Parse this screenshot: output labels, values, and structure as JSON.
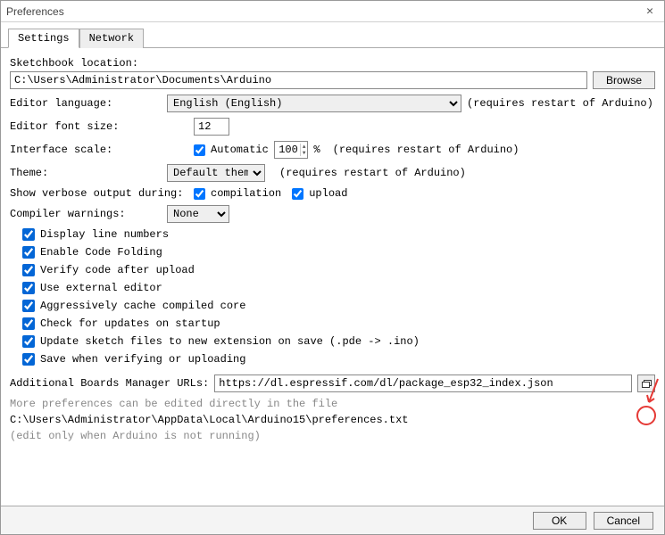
{
  "titlebar": {
    "title": "Preferences"
  },
  "tabs": {
    "settings": "Settings",
    "network": "Network"
  },
  "sketchbook": {
    "label": "Sketchbook location:",
    "path": "C:\\Users\\Administrator\\Documents\\Arduino",
    "browse": "Browse"
  },
  "editor_language": {
    "label": "Editor language:",
    "value": "English (English)",
    "note": "(requires restart of Arduino)"
  },
  "font_size": {
    "label": "Editor font size:",
    "value": "12"
  },
  "interface_scale": {
    "label": "Interface scale:",
    "automatic": "Automatic",
    "value": "100",
    "percent": "%",
    "note": "(requires restart of Arduino)"
  },
  "theme": {
    "label": "Theme:",
    "value": "Default theme",
    "note": "(requires restart of Arduino)"
  },
  "verbose": {
    "label": "Show verbose output during:",
    "compilation": "compilation",
    "upload": "upload"
  },
  "compiler_warnings": {
    "label": "Compiler warnings:",
    "value": "None"
  },
  "checks": {
    "line_numbers": "Display line numbers",
    "code_folding": "Enable Code Folding",
    "verify_after_upload": "Verify code after upload",
    "external_editor": "Use external editor",
    "cache_core": "Aggressively cache compiled core",
    "check_updates": "Check for updates on startup",
    "update_sketch": "Update sketch files to new extension on save (.pde -> .ino)",
    "save_verify": "Save when verifying or uploading"
  },
  "boards_url": {
    "label": "Additional Boards Manager URLs:",
    "value": "https://dl.espressif.com/dl/package_esp32_index.json"
  },
  "more_prefs": {
    "line1": "More preferences can be edited directly in the file",
    "line2": "C:\\Users\\Administrator\\AppData\\Local\\Arduino15\\preferences.txt",
    "line3": "(edit only when Arduino is not running)"
  },
  "footer": {
    "ok": "OK",
    "cancel": "Cancel"
  }
}
